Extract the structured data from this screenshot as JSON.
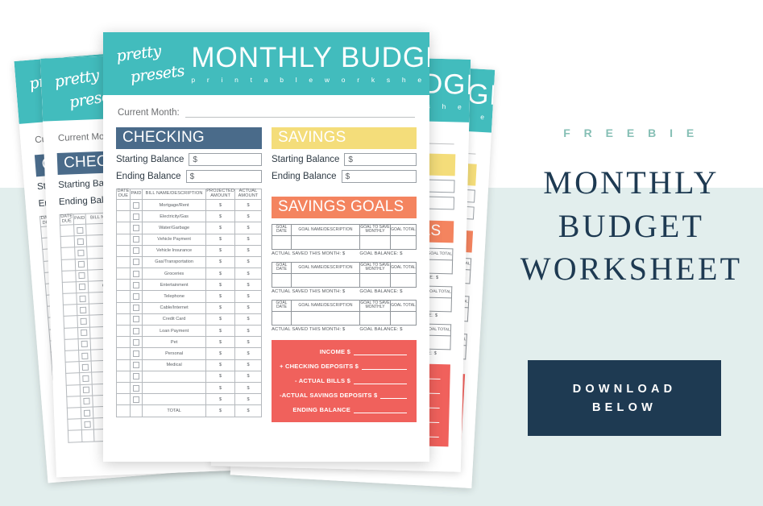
{
  "theme": {
    "bg_top": "#ffffff",
    "bg_bottom": "#e2eeed",
    "teal": "#42bcbd",
    "navy": "#1e3a52",
    "checking_band": "#4a6b8a",
    "savings_band": "#f4dd7a",
    "goals_band": "#f4845f",
    "summary_box": "#f0615c",
    "freebie_green": "#86bfb5",
    "total_green": "#5cb85c"
  },
  "worksheet": {
    "brand_line1": "pretty",
    "brand_line2": "presets",
    "title": "MONTHLY BUDGET",
    "subtitle": "p r i n t a b l e   w o r k s h e e t",
    "current_month_label": "Current Month:",
    "current_month_value": "",
    "checking": {
      "heading": "CHECKING",
      "starting_balance_label": "Starting Balance",
      "starting_balance_value": "$",
      "ending_balance_label": "Ending Balance",
      "ending_balance_value": "$",
      "columns": [
        "DATE DUE",
        "PAID",
        "BILL NAME/DESCRIPTION",
        "PROJECTED AMOUNT",
        "ACTUAL AMOUNT"
      ],
      "col_date": "DATE DUE",
      "col_paid": "PAID",
      "col_name": "BILL NAME/DESCRIPTION",
      "col_projected": "PROJECTED AMOUNT",
      "col_actual": "ACTUAL AMOUNT",
      "rows": [
        "Mortgage/Rent",
        "Electricity/Gas",
        "Water/Garbage",
        "Vehicle Payment",
        "Vehicle Insurance",
        "Gas/Transportation",
        "Groceries",
        "Entertainment",
        "Telephone",
        "Cable/Internet",
        "Credit Card",
        "Loan Payment",
        "Pet",
        "Personal",
        "Medical",
        "",
        "",
        ""
      ],
      "money_placeholder": "$",
      "total_label": "TOTAL",
      "total_projected": "$",
      "total_actual": "$"
    },
    "savings": {
      "heading": "SAVINGS",
      "starting_balance_label": "Starting Balance",
      "starting_balance_value": "$",
      "ending_balance_label": "Ending Balance",
      "ending_balance_value": "$"
    },
    "savings_goals": {
      "heading": "SAVINGS GOALS",
      "col_date": "GOAL DATE",
      "col_name": "GOAL NAME/DESCRIPTION",
      "col_monthly": "GOAL TO SAVE MONTHLY",
      "col_total": "GOAL TOTAL",
      "foot_saved": "ACTUAL SAVED THIS MONTH: $",
      "foot_balance": "GOAL BALANCE: $",
      "block_count": 3
    },
    "summary": {
      "rows": [
        {
          "label": "INCOME $"
        },
        {
          "label": "+ CHECKING DEPOSITS $"
        },
        {
          "label": "- ACTUAL BILLS $"
        },
        {
          "label": "-ACTUAL SAVINGS DEPOSITS $"
        },
        {
          "label": "ENDING BALANCE"
        }
      ]
    }
  },
  "right_panel": {
    "eyebrow": "F R E E B I E",
    "title_line1": "MONTHLY",
    "title_line2": "BUDGET",
    "title_line3": "WORKSHEET",
    "cta_line1": "DOWNLOAD",
    "cta_line2": "BELOW"
  }
}
